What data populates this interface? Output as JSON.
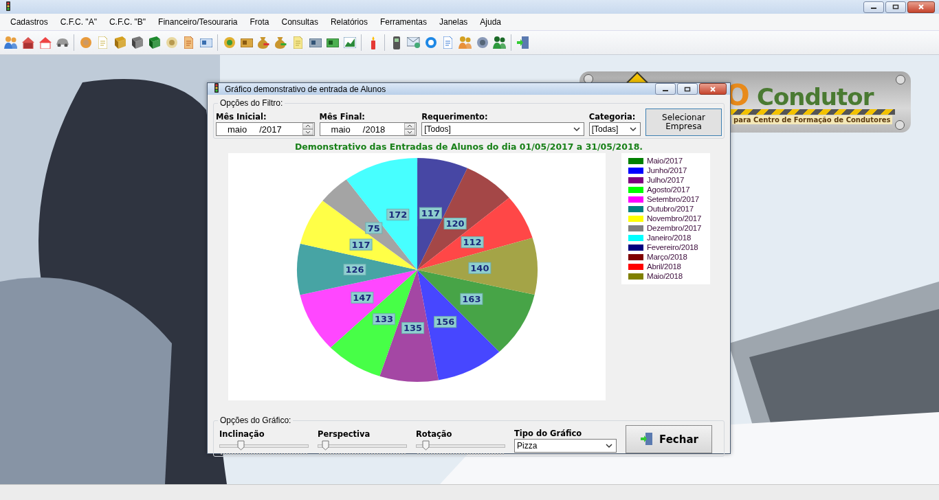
{
  "menu": [
    {
      "label": "Cadastros"
    },
    {
      "label": "C.F.C. \"A\""
    },
    {
      "label": "C.F.C. \"B\""
    },
    {
      "label": "Financeiro/Tesouraria"
    },
    {
      "label": "Frota"
    },
    {
      "label": "Consultas"
    },
    {
      "label": "Relatórios"
    },
    {
      "label": "Ferramentas"
    },
    {
      "label": "Janelas"
    },
    {
      "label": "Ajuda"
    }
  ],
  "splash": {
    "logo_letter": "O",
    "logo_word": "Condutor",
    "tagline": "para Centro de Formação de Condutores"
  },
  "dialog": {
    "title": "Gráfico demonstrativo de entrada de Alunos",
    "filter_group": {
      "title": "Opções do Filtro:",
      "start_month": {
        "label": "Mês Inicial:",
        "month": "maio",
        "year": "/2017"
      },
      "end_month": {
        "label": "Mês Final:",
        "month": "maio",
        "year": "/2018"
      },
      "requirement": {
        "label": "Requerimento:",
        "value": "[Todos]"
      },
      "category": {
        "label": "Categoria:",
        "value": "[Todas]"
      },
      "select_company_button": "Selecionar Empresa"
    },
    "chart_heading": "Demonstrativo das Entradas de Alunos do dia 01/05/2017 a 31/05/2018.",
    "chart_data": {
      "type": "pie",
      "values": [
        163,
        156,
        135,
        133,
        147,
        126,
        117,
        75,
        172,
        117,
        120,
        112,
        140
      ],
      "data_labels": true
    },
    "legend": [
      {
        "label": "Maio/2017",
        "color": "#008000"
      },
      {
        "label": "Junho/2017",
        "color": "#0000ff"
      },
      {
        "label": "Julho/2017",
        "color": "#800080"
      },
      {
        "label": "Agosto/2017",
        "color": "#00ff00"
      },
      {
        "label": "Setembro/2017",
        "color": "#ff00ff"
      },
      {
        "label": "Outubro/2017",
        "color": "#008080"
      },
      {
        "label": "Novembro/2017",
        "color": "#ffff00"
      },
      {
        "label": "Dezembro/2017",
        "color": "#808080"
      },
      {
        "label": "Janeiro/2018",
        "color": "#00ffff"
      },
      {
        "label": "Fevereiro/2018",
        "color": "#000080"
      },
      {
        "label": "Março/2018",
        "color": "#800000"
      },
      {
        "label": "Abril/2018",
        "color": "#ff0000"
      },
      {
        "label": "Maio/2018",
        "color": "#808000"
      }
    ],
    "chart_options": {
      "title": "Opções do Gráfico:",
      "sliders": [
        {
          "label": "Inclinação",
          "level": 0.22
        },
        {
          "label": "Perspectiva",
          "level": 0.05
        },
        {
          "label": "Rotação",
          "level": 0.08
        }
      ],
      "chart_type": {
        "label": "Tipo do Gráfico",
        "value": "Pizza"
      }
    },
    "close_button": "Fechar"
  }
}
